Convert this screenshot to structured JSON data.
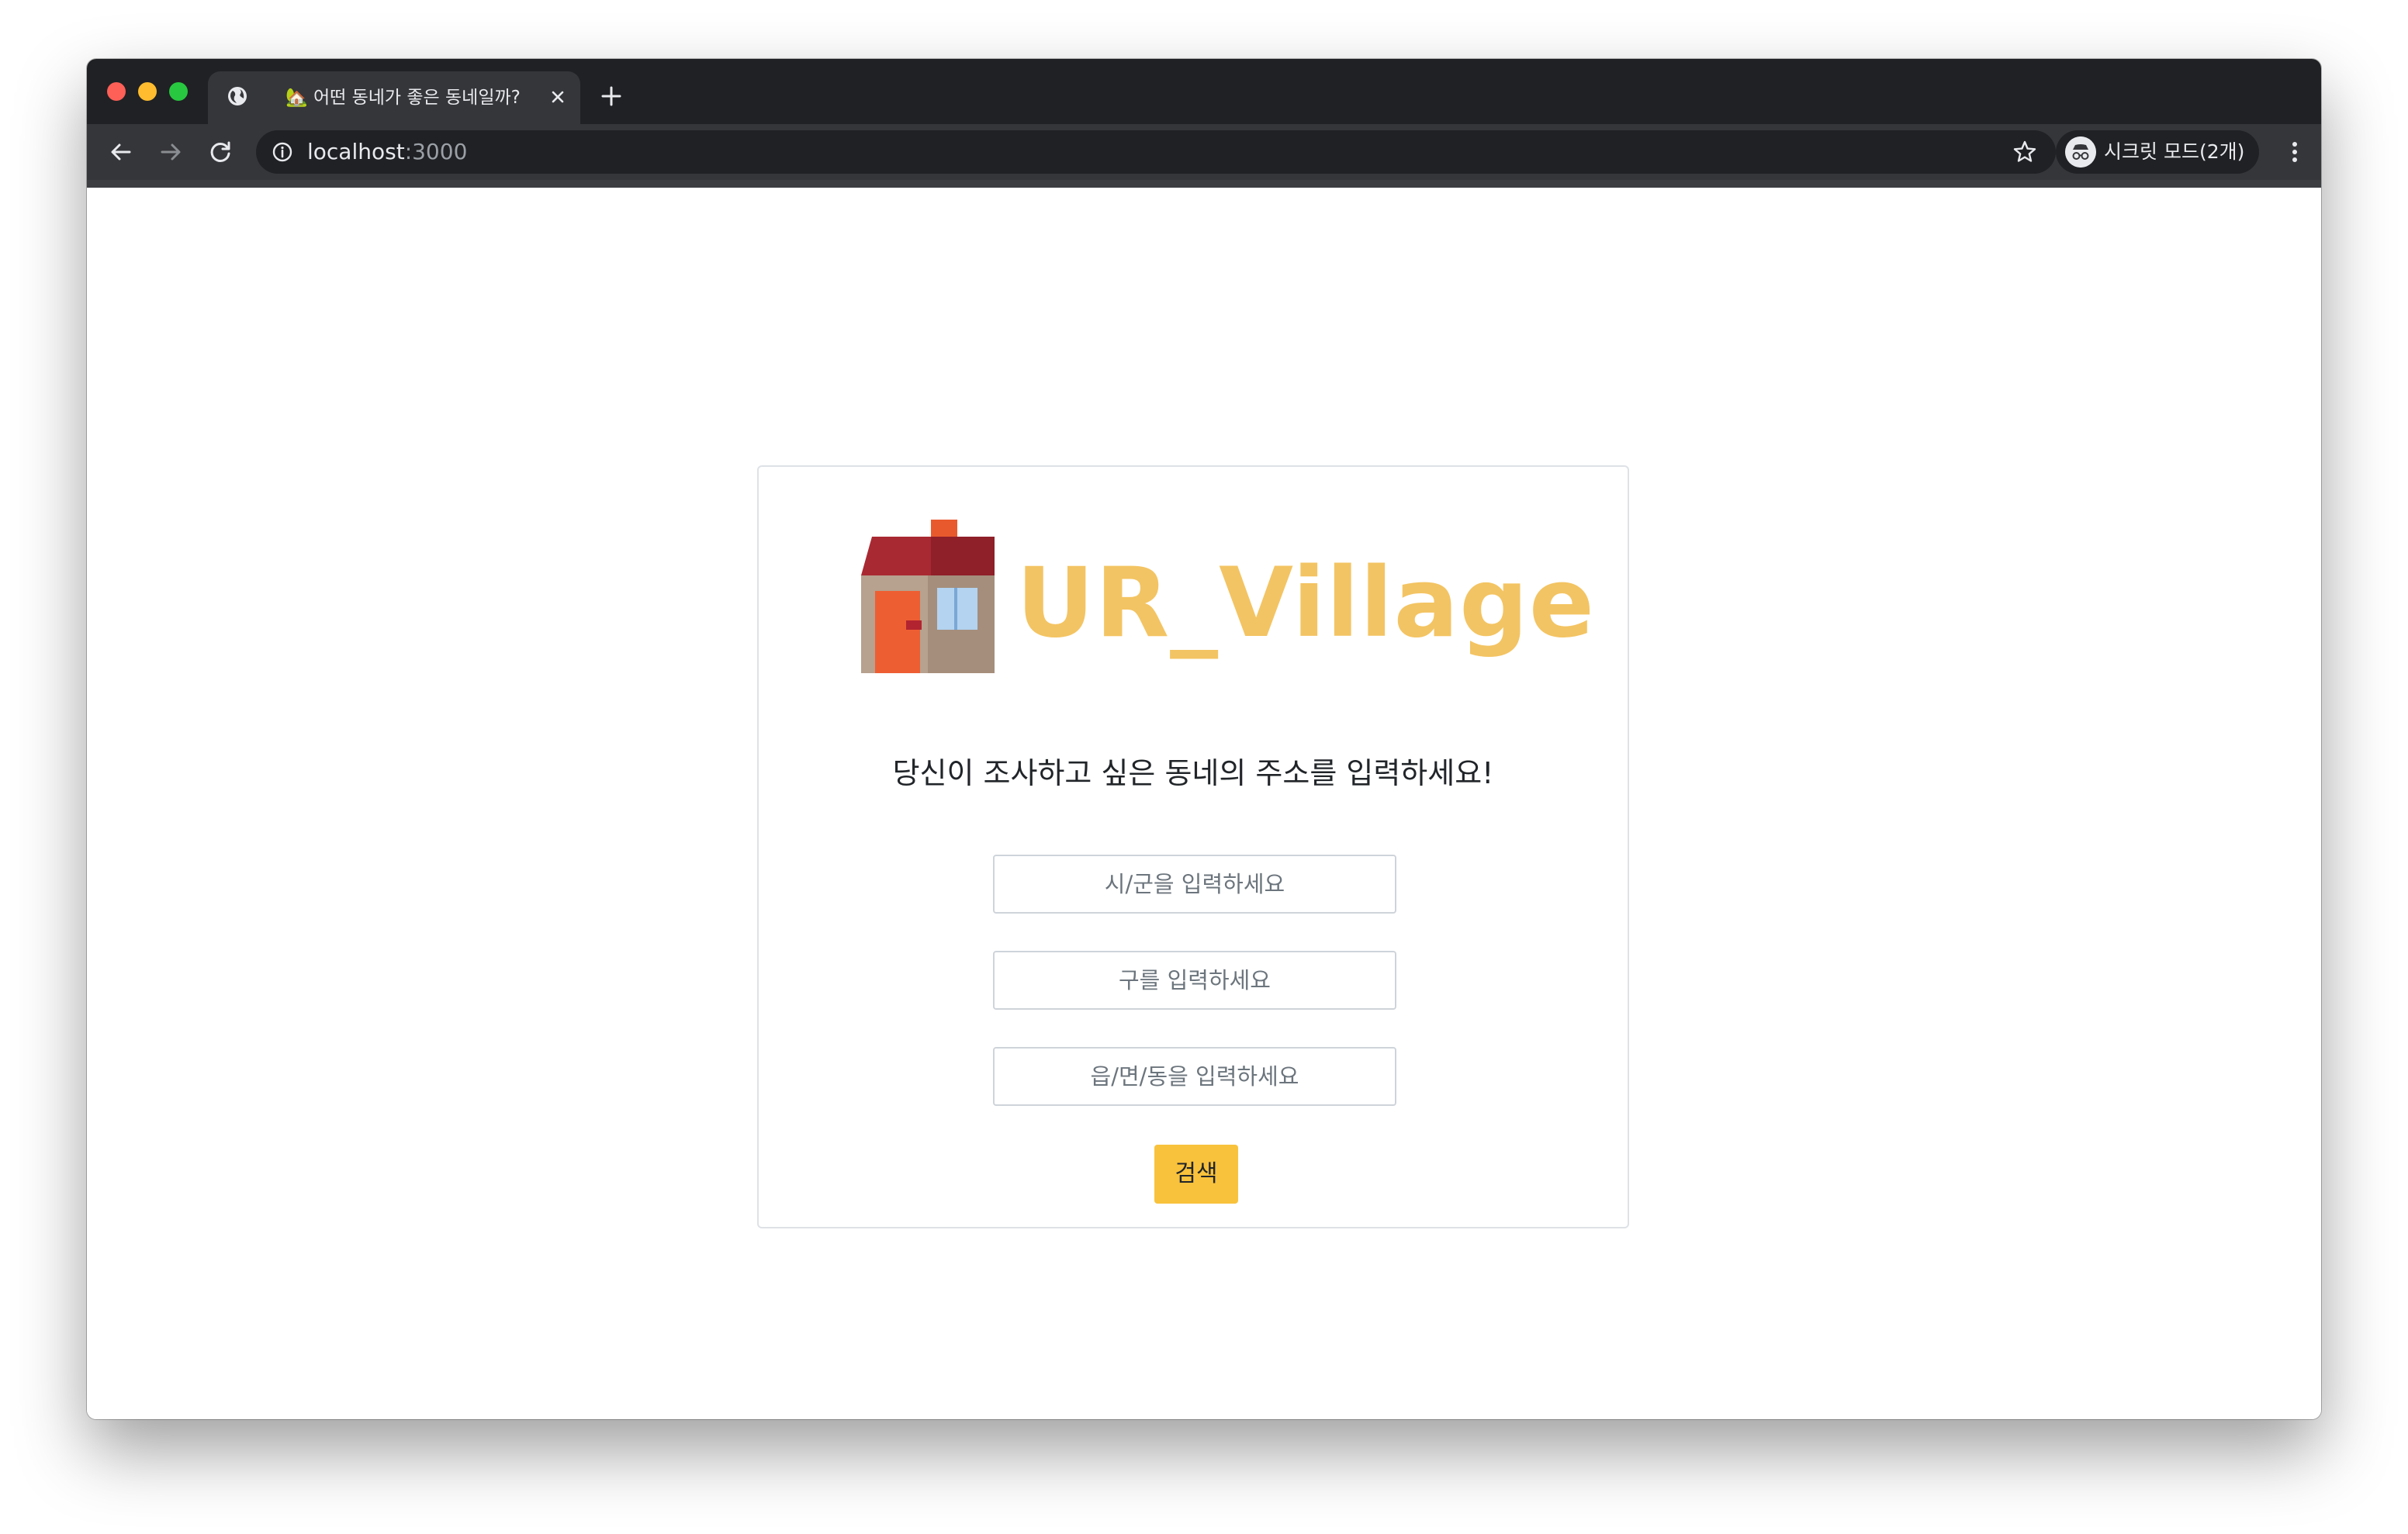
{
  "browser": {
    "tab": {
      "title": "🏡 어떤 동네가 좋은 동네일까?"
    },
    "address_bar": {
      "host": "localhost",
      "port": ":3000"
    },
    "profile_label": "시크릿 모드(2개)",
    "icons": [
      "globe-icon",
      "close-icon",
      "plus-icon",
      "back-arrow-icon",
      "forward-arrow-icon",
      "reload-icon",
      "info-icon",
      "star-icon",
      "incognito-icon",
      "kebab-menu-icon"
    ]
  },
  "page": {
    "logo": {
      "text": "UR_Village",
      "color": "#f3c463"
    },
    "prompt": "당신이 조사하고 싶은 동네의 주소를 입력하세요!",
    "form": {
      "city_placeholder": "시/군을 입력하세요",
      "district_placeholder": "구를 입력하세요",
      "town_placeholder": "읍/면/동을 입력하세요",
      "search_label": "검색"
    },
    "colors": {
      "button": "#f9c23c",
      "card_border": "#dee2e6"
    }
  }
}
